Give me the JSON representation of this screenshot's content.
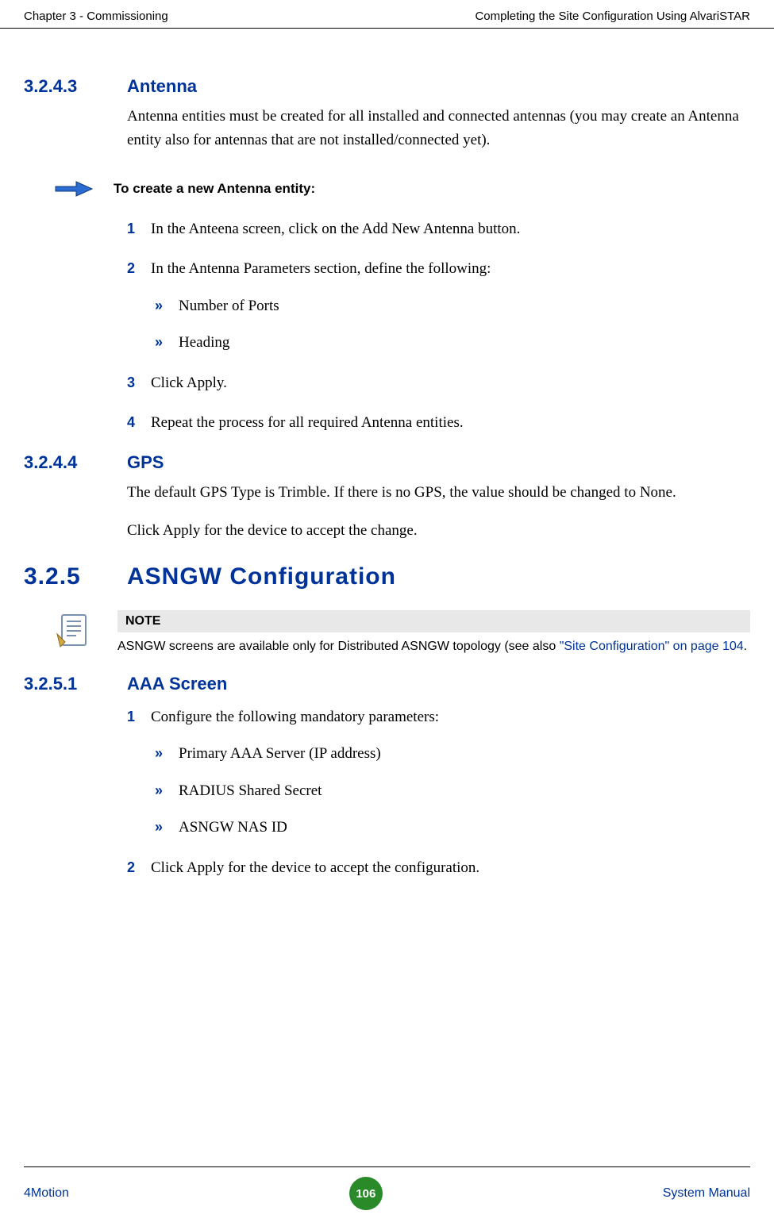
{
  "header": {
    "left": "Chapter 3 - Commissioning",
    "right": "Completing the Site Configuration Using AlvariSTAR"
  },
  "s1": {
    "num": "3.2.4.3",
    "title": "Antenna",
    "para": "Antenna entities must be created for all installed and connected antennas (you may create an Antenna entity also for antennas that are not installed/connected yet)."
  },
  "proc1": {
    "title": "To create a new Antenna entity:",
    "step1": {
      "n": "1",
      "t": "In the Anteena screen, click on the Add New Antenna button."
    },
    "step2": {
      "n": "2",
      "t": "In the Antenna Parameters section, define the following:"
    },
    "b1": "Number of Ports",
    "b2": "Heading",
    "step3": {
      "n": "3",
      "t": "Click Apply."
    },
    "step4": {
      "n": "4",
      "t": "Repeat the process for all required Antenna entities."
    }
  },
  "s2": {
    "num": "3.2.4.4",
    "title": "GPS",
    "para1": "The default GPS Type is Trimble. If there is no GPS, the value should be changed to None.",
    "para2": "Click Apply for the device to accept the change."
  },
  "s3": {
    "num": "3.2.5",
    "title": "ASNGW Configuration"
  },
  "note": {
    "label": "NOTE",
    "text1": "ASNGW screens are available only for Distributed ASNGW topology (see also ",
    "link": "\"Site Configuration\" on page 104",
    "text2": "."
  },
  "s4": {
    "num": "3.2.5.1",
    "title": "AAA Screen",
    "step1": {
      "n": "1",
      "t": "Configure the following mandatory parameters:"
    },
    "b1": "Primary AAA Server (IP address)",
    "b2": "RADIUS Shared Secret",
    "b3": "ASNGW NAS ID",
    "step2": {
      "n": "2",
      "t": "Click Apply for the device to accept the configuration."
    }
  },
  "footer": {
    "left": "4Motion",
    "page": "106",
    "right": " System Manual"
  },
  "glyphs": {
    "bullet": "»"
  }
}
